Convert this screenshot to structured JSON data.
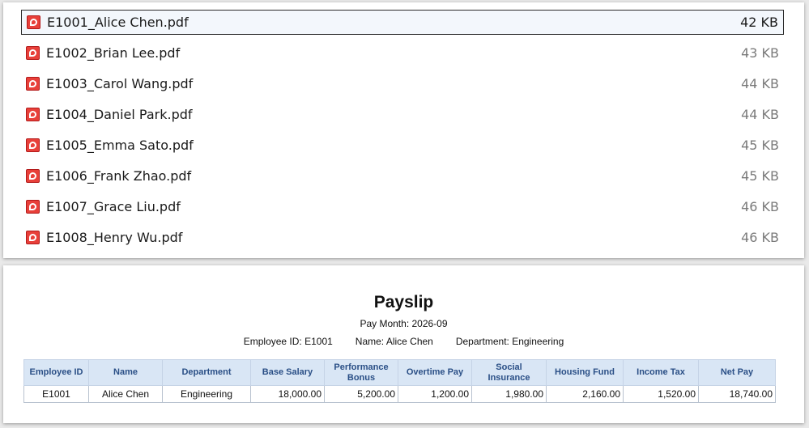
{
  "files": [
    {
      "name": "E1001_Alice Chen.pdf",
      "size": "42 KB",
      "selected": true
    },
    {
      "name": "E1002_Brian Lee.pdf",
      "size": "43 KB"
    },
    {
      "name": "E1003_Carol Wang.pdf",
      "size": "44 KB"
    },
    {
      "name": "E1004_Daniel Park.pdf",
      "size": "44 KB"
    },
    {
      "name": "E1005_Emma Sato.pdf",
      "size": "45 KB"
    },
    {
      "name": "E1006_Frank Zhao.pdf",
      "size": "45 KB"
    },
    {
      "name": "E1007_Grace Liu.pdf",
      "size": "46 KB"
    },
    {
      "name": "E1008_Henry Wu.pdf",
      "size": "46 KB"
    }
  ],
  "icons": {
    "file": "pdf-file-icon"
  },
  "payslip": {
    "title": "Payslip",
    "pay_month": "Pay Month: 2026-09",
    "employee_id": "Employee ID: E1001",
    "name": "Name: Alice Chen",
    "department": "Department: Engineering",
    "columns": [
      "Employee ID",
      "Name",
      "Department",
      "Base Salary",
      "Performance Bonus",
      "Overtime Pay",
      "Social Insurance",
      "Housing Fund",
      "Income Tax",
      "Net Pay"
    ],
    "row": [
      "E1001",
      "Alice Chen",
      "Engineering",
      "18,000.00",
      "5,200.00",
      "1,200.00",
      "1,980.00",
      "2,160.00",
      "1,520.00",
      "18,740.00"
    ]
  },
  "colors": {
    "header_bg": "#d9e6f5",
    "header_text": "#2a4f86",
    "pdf_red": "#e8403a"
  }
}
